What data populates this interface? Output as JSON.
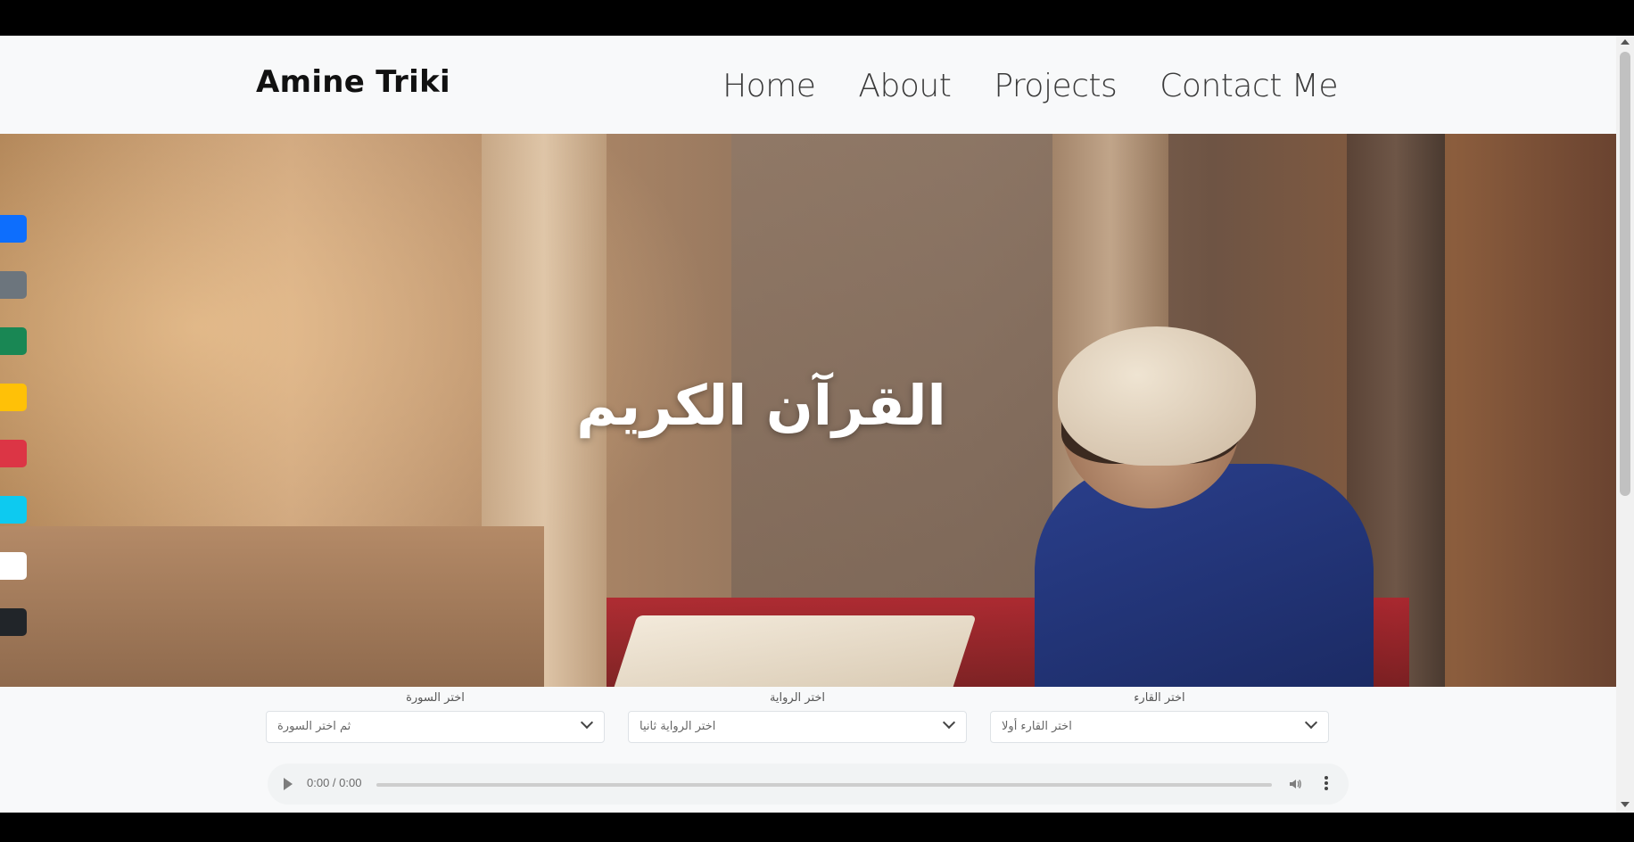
{
  "navbar": {
    "brand": "Amine Triki",
    "links": [
      "Home",
      "About",
      "Projects",
      "Contact Me"
    ]
  },
  "hero": {
    "title": "القرآن الكريم"
  },
  "social_colors": [
    "#0d6efd",
    "#6c757d",
    "#198754",
    "#ffc107",
    "#dc3545",
    "#0dcaf0",
    "#f8f9fa",
    "#212529"
  ],
  "controls": {
    "surah": {
      "label": "اختر السورة",
      "value": "ثم اختر السورة"
    },
    "riwaya": {
      "label": "اختر الرواية",
      "value": "اختر الرواية ثانيا"
    },
    "reciter": {
      "label": "اختر القارء",
      "value": "اختر القارء أولا"
    }
  },
  "player": {
    "time": "0:00 / 0:00"
  }
}
